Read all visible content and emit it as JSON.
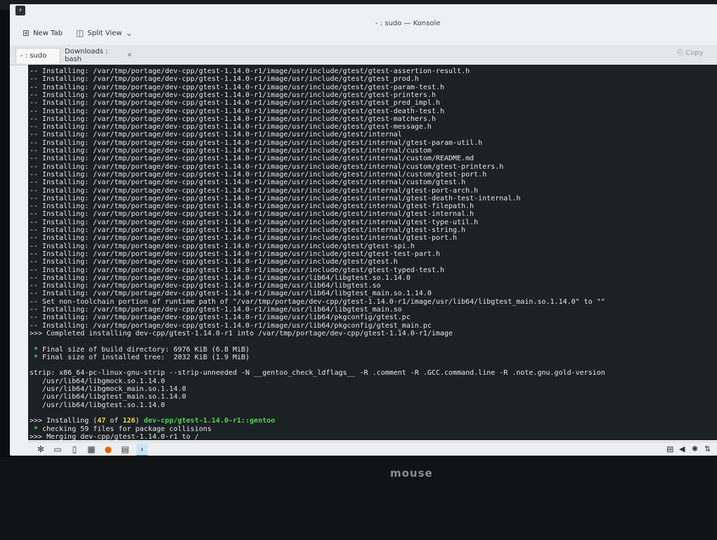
{
  "window": {
    "title": "- : sudo — Konsole"
  },
  "toolbar": {
    "new_tab": "New Tab",
    "split_view": "Split View",
    "copy": "Copy"
  },
  "tabs": [
    {
      "label": "- : sudo",
      "active": true
    },
    {
      "label": "Downloads : bash",
      "active": false
    }
  ],
  "terminal": {
    "lines": [
      {
        "parts": [
          {
            "t": "-- Installing: /var/tmp/portage/dev-cpp/gtest-1.14.0-r1/image/usr/include/gtest/gtest-assertion-result.h"
          }
        ]
      },
      {
        "parts": [
          {
            "t": "-- Installing: /var/tmp/portage/dev-cpp/gtest-1.14.0-r1/image/usr/include/gtest/gtest_prod.h"
          }
        ]
      },
      {
        "parts": [
          {
            "t": "-- Installing: /var/tmp/portage/dev-cpp/gtest-1.14.0-r1/image/usr/include/gtest/gtest-param-test.h"
          }
        ]
      },
      {
        "parts": [
          {
            "t": "-- Installing: /var/tmp/portage/dev-cpp/gtest-1.14.0-r1/image/usr/include/gtest/gtest-printers.h"
          }
        ]
      },
      {
        "parts": [
          {
            "t": "-- Installing: /var/tmp/portage/dev-cpp/gtest-1.14.0-r1/image/usr/include/gtest/gtest_pred_impl.h"
          }
        ]
      },
      {
        "parts": [
          {
            "t": "-- Installing: /var/tmp/portage/dev-cpp/gtest-1.14.0-r1/image/usr/include/gtest/gtest-death-test.h"
          }
        ]
      },
      {
        "parts": [
          {
            "t": "-- Installing: /var/tmp/portage/dev-cpp/gtest-1.14.0-r1/image/usr/include/gtest/gtest-matchers.h"
          }
        ]
      },
      {
        "parts": [
          {
            "t": "-- Installing: /var/tmp/portage/dev-cpp/gtest-1.14.0-r1/image/usr/include/gtest/gtest-message.h"
          }
        ]
      },
      {
        "parts": [
          {
            "t": "-- Installing: /var/tmp/portage/dev-cpp/gtest-1.14.0-r1/image/usr/include/gtest/internal"
          }
        ]
      },
      {
        "parts": [
          {
            "t": "-- Installing: /var/tmp/portage/dev-cpp/gtest-1.14.0-r1/image/usr/include/gtest/internal/gtest-param-util.h"
          }
        ]
      },
      {
        "parts": [
          {
            "t": "-- Installing: /var/tmp/portage/dev-cpp/gtest-1.14.0-r1/image/usr/include/gtest/internal/custom"
          }
        ]
      },
      {
        "parts": [
          {
            "t": "-- Installing: /var/tmp/portage/dev-cpp/gtest-1.14.0-r1/image/usr/include/gtest/internal/custom/README.md"
          }
        ]
      },
      {
        "parts": [
          {
            "t": "-- Installing: /var/tmp/portage/dev-cpp/gtest-1.14.0-r1/image/usr/include/gtest/internal/custom/gtest-printers.h"
          }
        ]
      },
      {
        "parts": [
          {
            "t": "-- Installing: /var/tmp/portage/dev-cpp/gtest-1.14.0-r1/image/usr/include/gtest/internal/custom/gtest-port.h"
          }
        ]
      },
      {
        "parts": [
          {
            "t": "-- Installing: /var/tmp/portage/dev-cpp/gtest-1.14.0-r1/image/usr/include/gtest/internal/custom/gtest.h"
          }
        ]
      },
      {
        "parts": [
          {
            "t": "-- Installing: /var/tmp/portage/dev-cpp/gtest-1.14.0-r1/image/usr/include/gtest/internal/gtest-port-arch.h"
          }
        ]
      },
      {
        "parts": [
          {
            "t": "-- Installing: /var/tmp/portage/dev-cpp/gtest-1.14.0-r1/image/usr/include/gtest/internal/gtest-death-test-internal.h"
          }
        ]
      },
      {
        "parts": [
          {
            "t": "-- Installing: /var/tmp/portage/dev-cpp/gtest-1.14.0-r1/image/usr/include/gtest/internal/gtest-filepath.h"
          }
        ]
      },
      {
        "parts": [
          {
            "t": "-- Installing: /var/tmp/portage/dev-cpp/gtest-1.14.0-r1/image/usr/include/gtest/internal/gtest-internal.h"
          }
        ]
      },
      {
        "parts": [
          {
            "t": "-- Installing: /var/tmp/portage/dev-cpp/gtest-1.14.0-r1/image/usr/include/gtest/internal/gtest-type-util.h"
          }
        ]
      },
      {
        "parts": [
          {
            "t": "-- Installing: /var/tmp/portage/dev-cpp/gtest-1.14.0-r1/image/usr/include/gtest/internal/gtest-string.h"
          }
        ]
      },
      {
        "parts": [
          {
            "t": "-- Installing: /var/tmp/portage/dev-cpp/gtest-1.14.0-r1/image/usr/include/gtest/internal/gtest-port.h"
          }
        ]
      },
      {
        "parts": [
          {
            "t": "-- Installing: /var/tmp/portage/dev-cpp/gtest-1.14.0-r1/image/usr/include/gtest/gtest-spi.h"
          }
        ]
      },
      {
        "parts": [
          {
            "t": "-- Installing: /var/tmp/portage/dev-cpp/gtest-1.14.0-r1/image/usr/include/gtest/gtest-test-part.h"
          }
        ]
      },
      {
        "parts": [
          {
            "t": "-- Installing: /var/tmp/portage/dev-cpp/gtest-1.14.0-r1/image/usr/include/gtest/gtest.h"
          }
        ]
      },
      {
        "parts": [
          {
            "t": "-- Installing: /var/tmp/portage/dev-cpp/gtest-1.14.0-r1/image/usr/include/gtest/gtest-typed-test.h"
          }
        ]
      },
      {
        "parts": [
          {
            "t": "-- Installing: /var/tmp/portage/dev-cpp/gtest-1.14.0-r1/image/usr/lib64/libgtest.so.1.14.0"
          }
        ]
      },
      {
        "parts": [
          {
            "t": "-- Installing: /var/tmp/portage/dev-cpp/gtest-1.14.0-r1/image/usr/lib64/libgtest.so"
          }
        ]
      },
      {
        "parts": [
          {
            "t": "-- Installing: /var/tmp/portage/dev-cpp/gtest-1.14.0-r1/image/usr/lib64/libgtest_main.so.1.14.0"
          }
        ]
      },
      {
        "parts": [
          {
            "t": "-- Set non-toolchain portion of runtime path of \"/var/tmp/portage/dev-cpp/gtest-1.14.0-r1/image/usr/lib64/libgtest_main.so.1.14.0\" to \"\""
          }
        ]
      },
      {
        "parts": [
          {
            "t": "-- Installing: /var/tmp/portage/dev-cpp/gtest-1.14.0-r1/image/usr/lib64/libgtest_main.so"
          }
        ]
      },
      {
        "parts": [
          {
            "t": "-- Installing: /var/tmp/portage/dev-cpp/gtest-1.14.0-r1/image/usr/lib64/pkgconfig/gtest.pc"
          }
        ]
      },
      {
        "parts": [
          {
            "t": "-- Installing: /var/tmp/portage/dev-cpp/gtest-1.14.0-r1/image/usr/lib64/pkgconfig/gtest_main.pc"
          }
        ]
      },
      {
        "parts": [
          {
            "t": ">>> Completed installing dev-cpp/gtest-1.14.0-r1 into /var/tmp/portage/dev-cpp/gtest-1.14.0-r1/image"
          }
        ]
      },
      {
        "parts": [
          {
            "t": ""
          }
        ]
      },
      {
        "parts": [
          {
            "t": " * ",
            "c": "g"
          },
          {
            "t": "Final size of build directory: 6976 KiB (6.8 MiB)"
          }
        ]
      },
      {
        "parts": [
          {
            "t": " * ",
            "c": "g"
          },
          {
            "t": "Final size of installed tree:  2032 KiB (1.9 MiB)"
          }
        ]
      },
      {
        "parts": [
          {
            "t": ""
          }
        ]
      },
      {
        "parts": [
          {
            "t": "strip: x86_64-pc-linux-gnu-strip --strip-unneeded -N __gentoo_check_ldflags__ -R .comment -R .GCC.command.line -R .note.gnu.gold-version"
          }
        ]
      },
      {
        "parts": [
          {
            "t": "   /usr/lib64/libgmock.so.1.14.0"
          }
        ]
      },
      {
        "parts": [
          {
            "t": "   /usr/lib64/libgmock_main.so.1.14.0"
          }
        ]
      },
      {
        "parts": [
          {
            "t": "   /usr/lib64/libgtest_main.so.1.14.0"
          }
        ]
      },
      {
        "parts": [
          {
            "t": "   /usr/lib64/libgtest.so.1.14.0"
          }
        ]
      },
      {
        "parts": [
          {
            "t": ""
          }
        ]
      },
      {
        "parts": [
          {
            "t": ">>> Installing ("
          },
          {
            "t": "47",
            "c": "y"
          },
          {
            "t": " of "
          },
          {
            "t": "126",
            "c": "y"
          },
          {
            "t": ") "
          },
          {
            "t": "dev-cpp/gtest-1.14.0-r1::gentoo",
            "c": "g"
          }
        ]
      },
      {
        "parts": [
          {
            "t": " * ",
            "c": "g"
          },
          {
            "t": "checking 59 files for package collisions"
          }
        ]
      },
      {
        "parts": [
          {
            "t": ">>> Merging dev-cpp/gtest-1.14.0-r1 to /"
          }
        ]
      }
    ]
  },
  "taskbar": {
    "icons": [
      "app-launcher-icon",
      "pager-icon",
      "file-icon",
      "folder-icon",
      "firefox-icon",
      "image-viewer-icon",
      "konsole-icon"
    ],
    "tray": [
      "clipboard-icon",
      "volume-icon",
      "brightness-icon",
      "network-icon"
    ]
  },
  "bezel": {
    "brand": "mouse"
  },
  "colors": {
    "terminal_bg": "#1c2124",
    "terminal_fg": "#e8e8e8",
    "green": "#4fd44f",
    "yellow": "#f0d64a",
    "accent": "#3daee9"
  }
}
